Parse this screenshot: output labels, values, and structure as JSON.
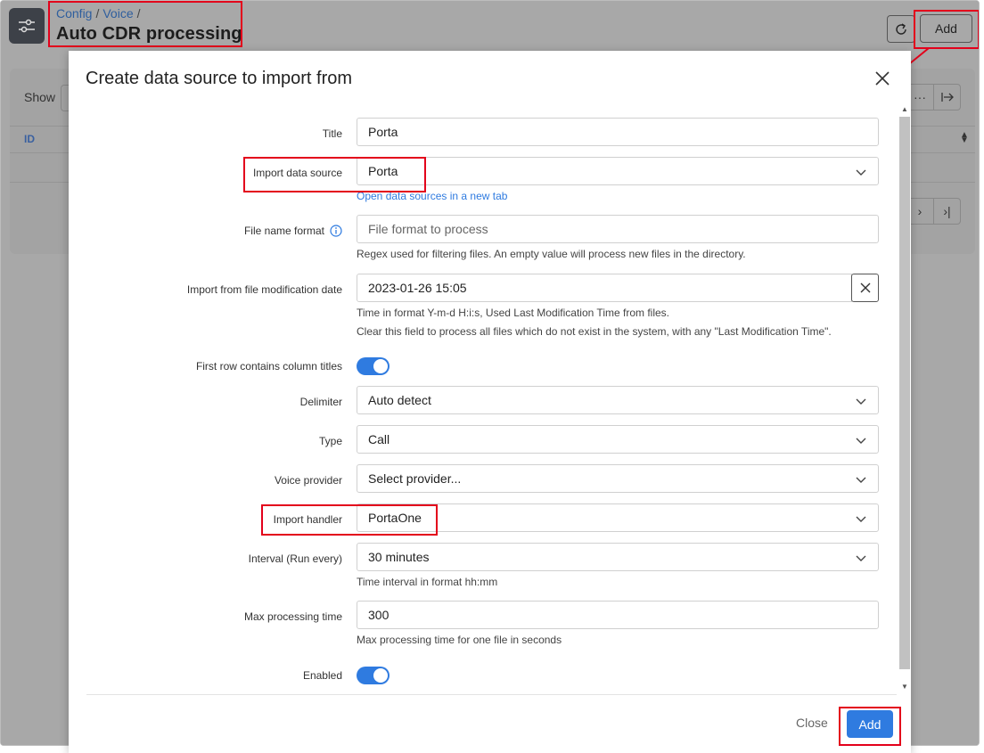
{
  "header": {
    "breadcrumb": [
      "Config",
      "Voice"
    ],
    "title": "Auto CDR processing",
    "add_label": "Add"
  },
  "background": {
    "show_label": "Show",
    "id_column": "ID"
  },
  "modal": {
    "title": "Create data source to import from",
    "fields": {
      "title": {
        "label": "Title",
        "value": "Porta"
      },
      "import_data_source": {
        "label": "Import data source",
        "value": "Porta",
        "link": "Open data sources in a new tab"
      },
      "file_name_format": {
        "label": "File name format",
        "placeholder": "File format to process",
        "hint": "Regex used for filtering files. An empty value will process new files in the directory."
      },
      "import_from_date": {
        "label": "Import from file modification date",
        "value": "2023-01-26 15:05",
        "hint1": "Time in format Y-m-d H:i:s, Used Last Modification Time from files.",
        "hint2": "Clear this field to process all files which do not exist in the system, with any \"Last Modification Time\"."
      },
      "first_row_titles": {
        "label": "First row contains column titles",
        "enabled": true
      },
      "delimiter": {
        "label": "Delimiter",
        "value": "Auto detect"
      },
      "type": {
        "label": "Type",
        "value": "Call"
      },
      "voice_provider": {
        "label": "Voice provider",
        "value": "Select provider..."
      },
      "import_handler": {
        "label": "Import handler",
        "value": "PortaOne"
      },
      "interval": {
        "label": "Interval (Run every)",
        "value": "30 minutes",
        "hint": "Time interval in format hh:mm"
      },
      "max_processing_time": {
        "label": "Max processing time",
        "value": "300",
        "hint": "Max processing time for one file in seconds"
      },
      "enabled": {
        "label": "Enabled",
        "enabled": true
      }
    },
    "footer": {
      "close_label": "Close",
      "add_label": "Add"
    }
  },
  "colors": {
    "accent": "#2f7be0",
    "highlight": "#e3001b",
    "overlay": "#a8a8a8"
  }
}
